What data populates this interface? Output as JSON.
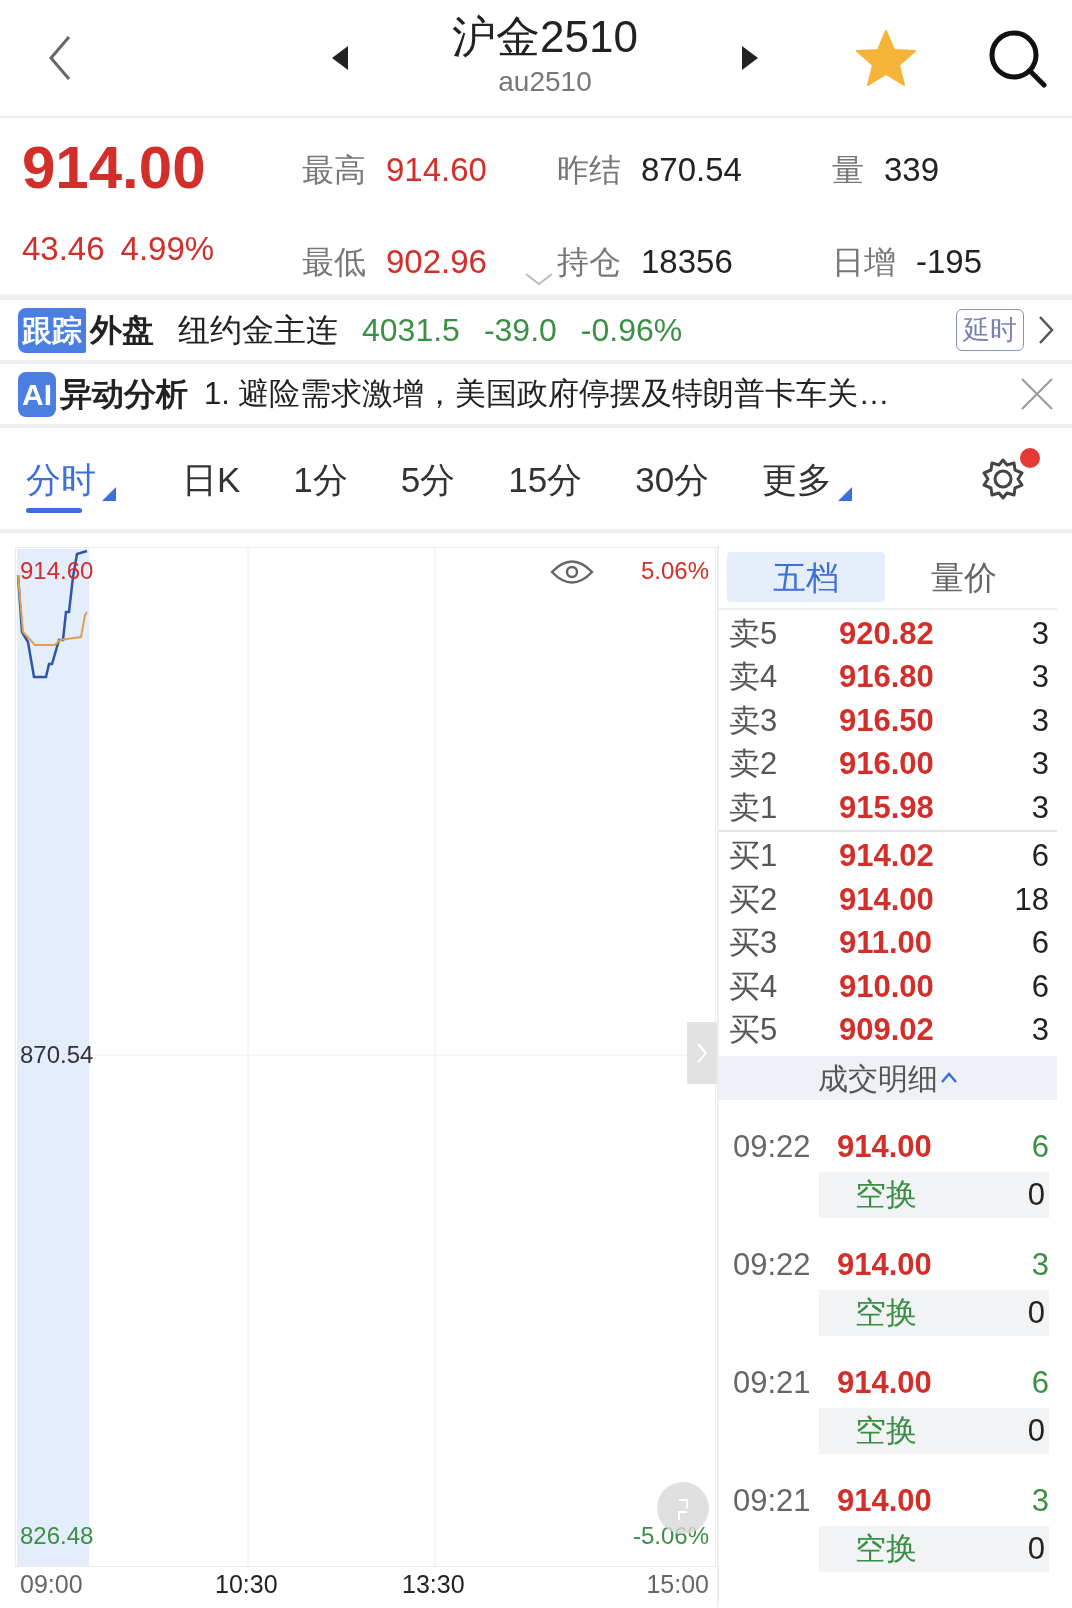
{
  "header": {
    "title": "沪金2510",
    "code": "au2510",
    "favorite": true
  },
  "quote": {
    "price": "914.00",
    "change": "43.46",
    "pct": "4.99%",
    "stats": [
      {
        "label": "最高",
        "value": "914.60",
        "kind": "up"
      },
      {
        "label": "昨结",
        "value": "870.54",
        "kind": "plain"
      },
      {
        "label": "量",
        "value": "339",
        "kind": "plain"
      },
      {
        "label": "最低",
        "value": "902.96",
        "kind": "up"
      },
      {
        "label": "持仓",
        "value": "18356",
        "kind": "plain"
      },
      {
        "label": "日增",
        "value": "-195",
        "kind": "plain"
      }
    ]
  },
  "foreign": {
    "tag": "跟踪",
    "label": "外盘",
    "name": "纽约金主连",
    "price": "4031.5",
    "change": "-39.0",
    "pct": "-0.96%",
    "badge": "延时"
  },
  "ai": {
    "tag": "AI",
    "label": "异动分析",
    "text": "1. 避险需求激增，美国政府停摆及特朗普卡车关…"
  },
  "tabs": [
    {
      "label": "分时",
      "selected": true,
      "dropdown": true
    },
    {
      "label": "日K",
      "selected": false,
      "dropdown": false
    },
    {
      "label": "1分",
      "selected": false,
      "dropdown": false
    },
    {
      "label": "5分",
      "selected": false,
      "dropdown": false
    },
    {
      "label": "15分",
      "selected": false,
      "dropdown": false
    },
    {
      "label": "30分",
      "selected": false,
      "dropdown": false
    },
    {
      "label": "更多",
      "selected": false,
      "dropdown": true
    }
  ],
  "settings": {
    "notification": true
  },
  "chart": {
    "high": "914.60",
    "high_pct": "5.06%",
    "mid": "870.54",
    "low": "826.48",
    "low_pct": "-5.06%",
    "times": [
      "09:00",
      "10:30",
      "13:30",
      "15:00"
    ]
  },
  "order_book": {
    "tabs": [
      {
        "label": "五档",
        "selected": true
      },
      {
        "label": "量价",
        "selected": false
      }
    ],
    "asks": [
      {
        "label": "卖5",
        "price": "920.82",
        "volume": "3"
      },
      {
        "label": "卖4",
        "price": "916.80",
        "volume": "3"
      },
      {
        "label": "卖3",
        "price": "916.50",
        "volume": "3"
      },
      {
        "label": "卖2",
        "price": "916.00",
        "volume": "3"
      },
      {
        "label": "卖1",
        "price": "915.98",
        "volume": "3"
      }
    ],
    "bids": [
      {
        "label": "买1",
        "price": "914.02",
        "volume": "6"
      },
      {
        "label": "买2",
        "price": "914.00",
        "volume": "18"
      },
      {
        "label": "买3",
        "price": "911.00",
        "volume": "6"
      },
      {
        "label": "买4",
        "price": "910.00",
        "volume": "6"
      },
      {
        "label": "买5",
        "price": "909.02",
        "volume": "3"
      }
    ],
    "detail_label": "成交明细"
  },
  "trades": [
    {
      "time": "09:22",
      "price": "914.00",
      "volume": "6",
      "type": "空换",
      "type_volume": "0"
    },
    {
      "time": "09:22",
      "price": "914.00",
      "volume": "3",
      "type": "空换",
      "type_volume": "0"
    },
    {
      "time": "09:21",
      "price": "914.00",
      "volume": "6",
      "type": "空换",
      "type_volume": "0"
    },
    {
      "time": "09:21",
      "price": "914.00",
      "volume": "3",
      "type": "空换",
      "type_volume": "0"
    }
  ]
}
